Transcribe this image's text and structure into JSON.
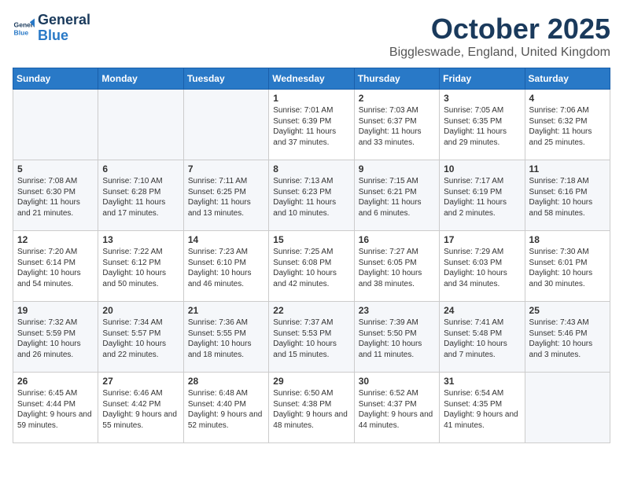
{
  "header": {
    "logo_line1": "General",
    "logo_line2": "Blue",
    "month": "October 2025",
    "location": "Biggleswade, England, United Kingdom"
  },
  "days_of_week": [
    "Sunday",
    "Monday",
    "Tuesday",
    "Wednesday",
    "Thursday",
    "Friday",
    "Saturday"
  ],
  "weeks": [
    [
      {
        "day": "",
        "content": ""
      },
      {
        "day": "",
        "content": ""
      },
      {
        "day": "",
        "content": ""
      },
      {
        "day": "1",
        "content": "Sunrise: 7:01 AM\nSunset: 6:39 PM\nDaylight: 11 hours and 37 minutes."
      },
      {
        "day": "2",
        "content": "Sunrise: 7:03 AM\nSunset: 6:37 PM\nDaylight: 11 hours and 33 minutes."
      },
      {
        "day": "3",
        "content": "Sunrise: 7:05 AM\nSunset: 6:35 PM\nDaylight: 11 hours and 29 minutes."
      },
      {
        "day": "4",
        "content": "Sunrise: 7:06 AM\nSunset: 6:32 PM\nDaylight: 11 hours and 25 minutes."
      }
    ],
    [
      {
        "day": "5",
        "content": "Sunrise: 7:08 AM\nSunset: 6:30 PM\nDaylight: 11 hours and 21 minutes."
      },
      {
        "day": "6",
        "content": "Sunrise: 7:10 AM\nSunset: 6:28 PM\nDaylight: 11 hours and 17 minutes."
      },
      {
        "day": "7",
        "content": "Sunrise: 7:11 AM\nSunset: 6:25 PM\nDaylight: 11 hours and 13 minutes."
      },
      {
        "day": "8",
        "content": "Sunrise: 7:13 AM\nSunset: 6:23 PM\nDaylight: 11 hours and 10 minutes."
      },
      {
        "day": "9",
        "content": "Sunrise: 7:15 AM\nSunset: 6:21 PM\nDaylight: 11 hours and 6 minutes."
      },
      {
        "day": "10",
        "content": "Sunrise: 7:17 AM\nSunset: 6:19 PM\nDaylight: 11 hours and 2 minutes."
      },
      {
        "day": "11",
        "content": "Sunrise: 7:18 AM\nSunset: 6:16 PM\nDaylight: 10 hours and 58 minutes."
      }
    ],
    [
      {
        "day": "12",
        "content": "Sunrise: 7:20 AM\nSunset: 6:14 PM\nDaylight: 10 hours and 54 minutes."
      },
      {
        "day": "13",
        "content": "Sunrise: 7:22 AM\nSunset: 6:12 PM\nDaylight: 10 hours and 50 minutes."
      },
      {
        "day": "14",
        "content": "Sunrise: 7:23 AM\nSunset: 6:10 PM\nDaylight: 10 hours and 46 minutes."
      },
      {
        "day": "15",
        "content": "Sunrise: 7:25 AM\nSunset: 6:08 PM\nDaylight: 10 hours and 42 minutes."
      },
      {
        "day": "16",
        "content": "Sunrise: 7:27 AM\nSunset: 6:05 PM\nDaylight: 10 hours and 38 minutes."
      },
      {
        "day": "17",
        "content": "Sunrise: 7:29 AM\nSunset: 6:03 PM\nDaylight: 10 hours and 34 minutes."
      },
      {
        "day": "18",
        "content": "Sunrise: 7:30 AM\nSunset: 6:01 PM\nDaylight: 10 hours and 30 minutes."
      }
    ],
    [
      {
        "day": "19",
        "content": "Sunrise: 7:32 AM\nSunset: 5:59 PM\nDaylight: 10 hours and 26 minutes."
      },
      {
        "day": "20",
        "content": "Sunrise: 7:34 AM\nSunset: 5:57 PM\nDaylight: 10 hours and 22 minutes."
      },
      {
        "day": "21",
        "content": "Sunrise: 7:36 AM\nSunset: 5:55 PM\nDaylight: 10 hours and 18 minutes."
      },
      {
        "day": "22",
        "content": "Sunrise: 7:37 AM\nSunset: 5:53 PM\nDaylight: 10 hours and 15 minutes."
      },
      {
        "day": "23",
        "content": "Sunrise: 7:39 AM\nSunset: 5:50 PM\nDaylight: 10 hours and 11 minutes."
      },
      {
        "day": "24",
        "content": "Sunrise: 7:41 AM\nSunset: 5:48 PM\nDaylight: 10 hours and 7 minutes."
      },
      {
        "day": "25",
        "content": "Sunrise: 7:43 AM\nSunset: 5:46 PM\nDaylight: 10 hours and 3 minutes."
      }
    ],
    [
      {
        "day": "26",
        "content": "Sunrise: 6:45 AM\nSunset: 4:44 PM\nDaylight: 9 hours and 59 minutes."
      },
      {
        "day": "27",
        "content": "Sunrise: 6:46 AM\nSunset: 4:42 PM\nDaylight: 9 hours and 55 minutes."
      },
      {
        "day": "28",
        "content": "Sunrise: 6:48 AM\nSunset: 4:40 PM\nDaylight: 9 hours and 52 minutes."
      },
      {
        "day": "29",
        "content": "Sunrise: 6:50 AM\nSunset: 4:38 PM\nDaylight: 9 hours and 48 minutes."
      },
      {
        "day": "30",
        "content": "Sunrise: 6:52 AM\nSunset: 4:37 PM\nDaylight: 9 hours and 44 minutes."
      },
      {
        "day": "31",
        "content": "Sunrise: 6:54 AM\nSunset: 4:35 PM\nDaylight: 9 hours and 41 minutes."
      },
      {
        "day": "",
        "content": ""
      }
    ]
  ]
}
